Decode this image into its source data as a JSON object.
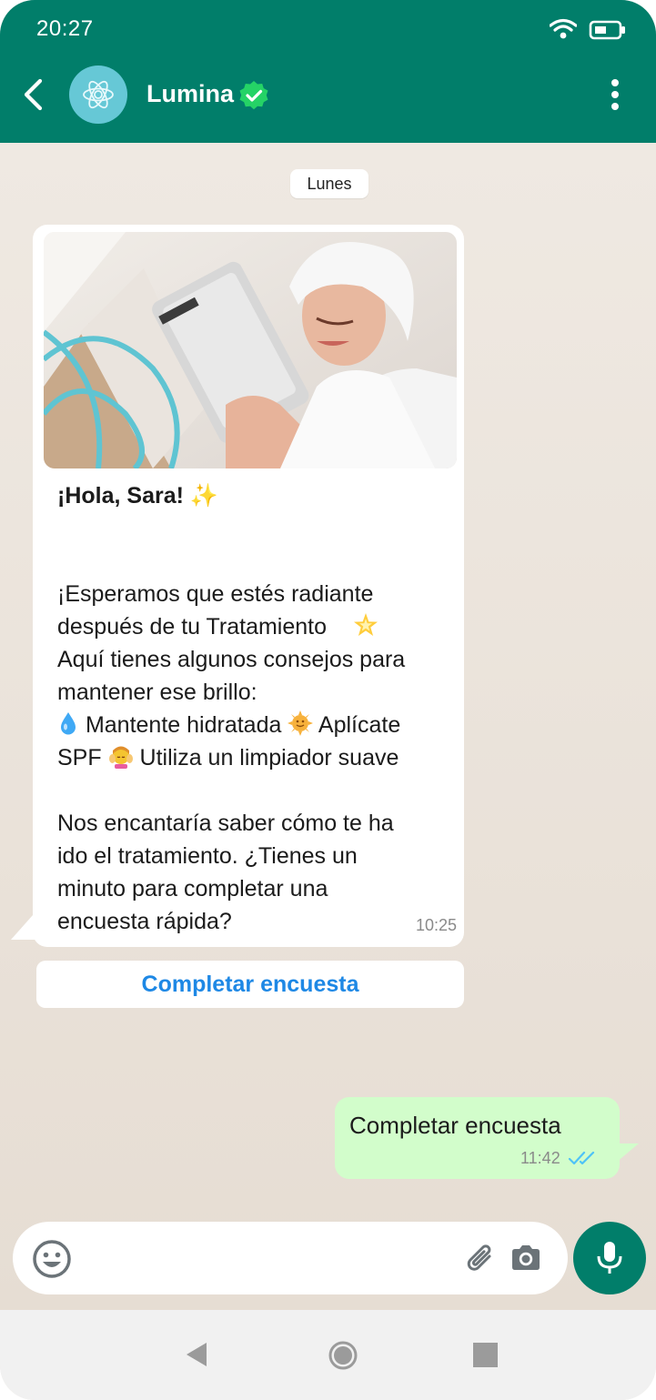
{
  "status_bar": {
    "time": "20:27"
  },
  "header": {
    "contact_name": "Lumina"
  },
  "chat": {
    "day_label": "Lunes",
    "incoming": {
      "greeting": "¡Hola, Sara!",
      "greeting_emoji": "✨",
      "lines": [
        "¡Esperamos que estés radiante",
        "después de tu Tratamiento",
        "Aquí tienes algunos consejos para",
        "mantener ese brillo:",
        "Mantente hidratada",
        "Aplícate",
        "SPF",
        "Utiliza un limpiador suave",
        "Nos encantaría saber cómo te ha",
        "ido el tratamiento. ¿Tienes un",
        "minuto para completar una",
        "encuesta rápida?"
      ],
      "time": "10:25"
    },
    "cta_button": "Completar encuesta",
    "outgoing": {
      "text": "Completar encuesta",
      "time": "11:42"
    }
  },
  "icons": [
    "back-arrow-icon",
    "lumina-logo-icon",
    "verified-icon",
    "more-vert-icon",
    "emoji-icon",
    "attach-icon",
    "camera-icon",
    "mic-icon",
    "double-check-icon",
    "sparkles-icon",
    "glowing-star-icon",
    "droplet-icon",
    "sun-icon",
    "face-massage-icon",
    "nav-back-icon",
    "nav-home-icon",
    "nav-recents-icon"
  ],
  "colors": {
    "header": "#017e6a",
    "link": "#1e88e5",
    "outgoing_bubble": "#d2fdcb",
    "read_ticks": "#4fc3f7"
  }
}
